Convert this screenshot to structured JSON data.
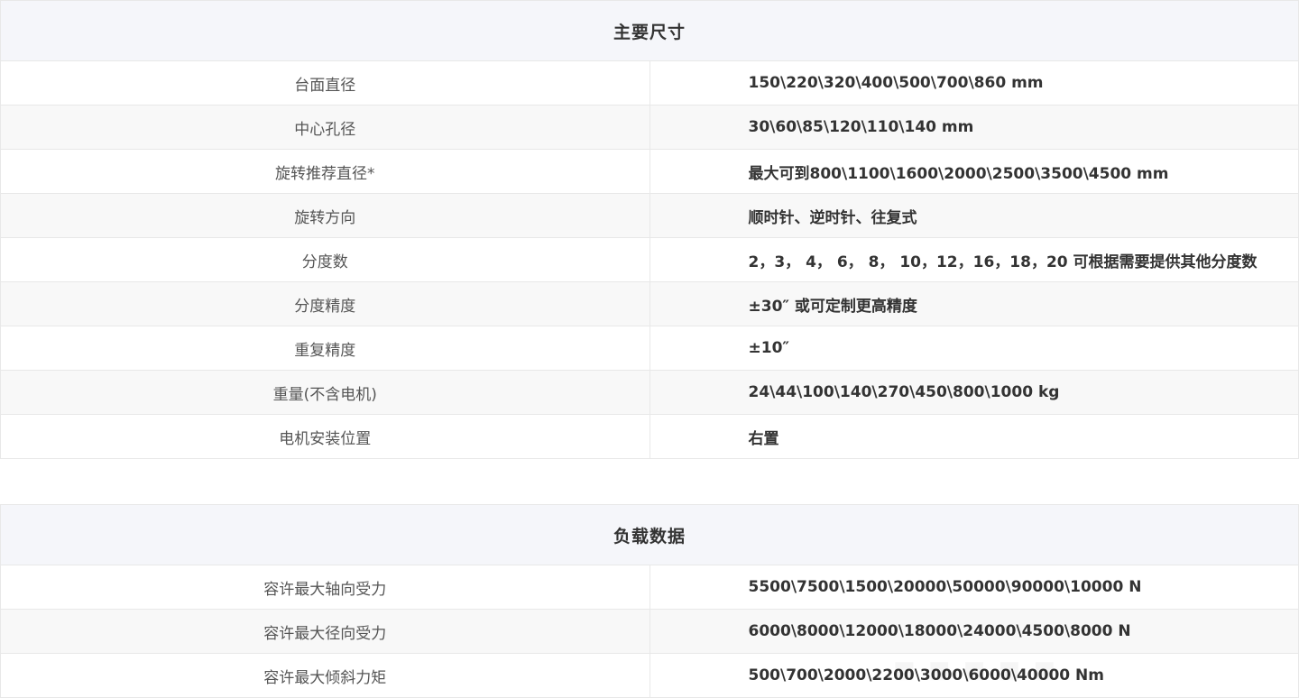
{
  "main_dimensions": {
    "title": "主要尺寸",
    "rows": [
      {
        "label": "台面直径",
        "value": "150\\220\\320\\400\\500\\700\\860 mm"
      },
      {
        "label": "中心孔径",
        "value": "30\\60\\85\\120\\110\\140 mm"
      },
      {
        "label": "旋转推荐直径*",
        "value": "最大可到800\\1100\\1600\\2000\\2500\\3500\\4500 mm"
      },
      {
        "label": "旋转方向",
        "value": "顺时针、逆时针、往复式"
      },
      {
        "label": "分度数",
        "value": "2，3， 4， 6， 8， 10，12，16，18，20  可根据需要提供其他分度数"
      },
      {
        "label": "分度精度",
        "value": "±30″  或可定制更高精度"
      },
      {
        "label": "重复精度",
        "value": "±10″"
      },
      {
        "label": "重量(不含电机)",
        "value": "24\\44\\100\\140\\270\\450\\800\\1000 kg"
      },
      {
        "label": "电机安装位置",
        "value": "右置"
      }
    ]
  },
  "load_data": {
    "title": "负载数据",
    "rows": [
      {
        "label": "容许最大轴向受力",
        "value": "5500\\7500\\1500\\20000\\50000\\90000\\10000 N"
      },
      {
        "label": "容许最大径向受力",
        "value": "6000\\8000\\12000\\18000\\24000\\4500\\8000 N"
      },
      {
        "label": "容许最大倾斜力矩",
        "value": "500\\700\\2000\\2200\\3000\\6000\\40000 Nm"
      }
    ]
  }
}
